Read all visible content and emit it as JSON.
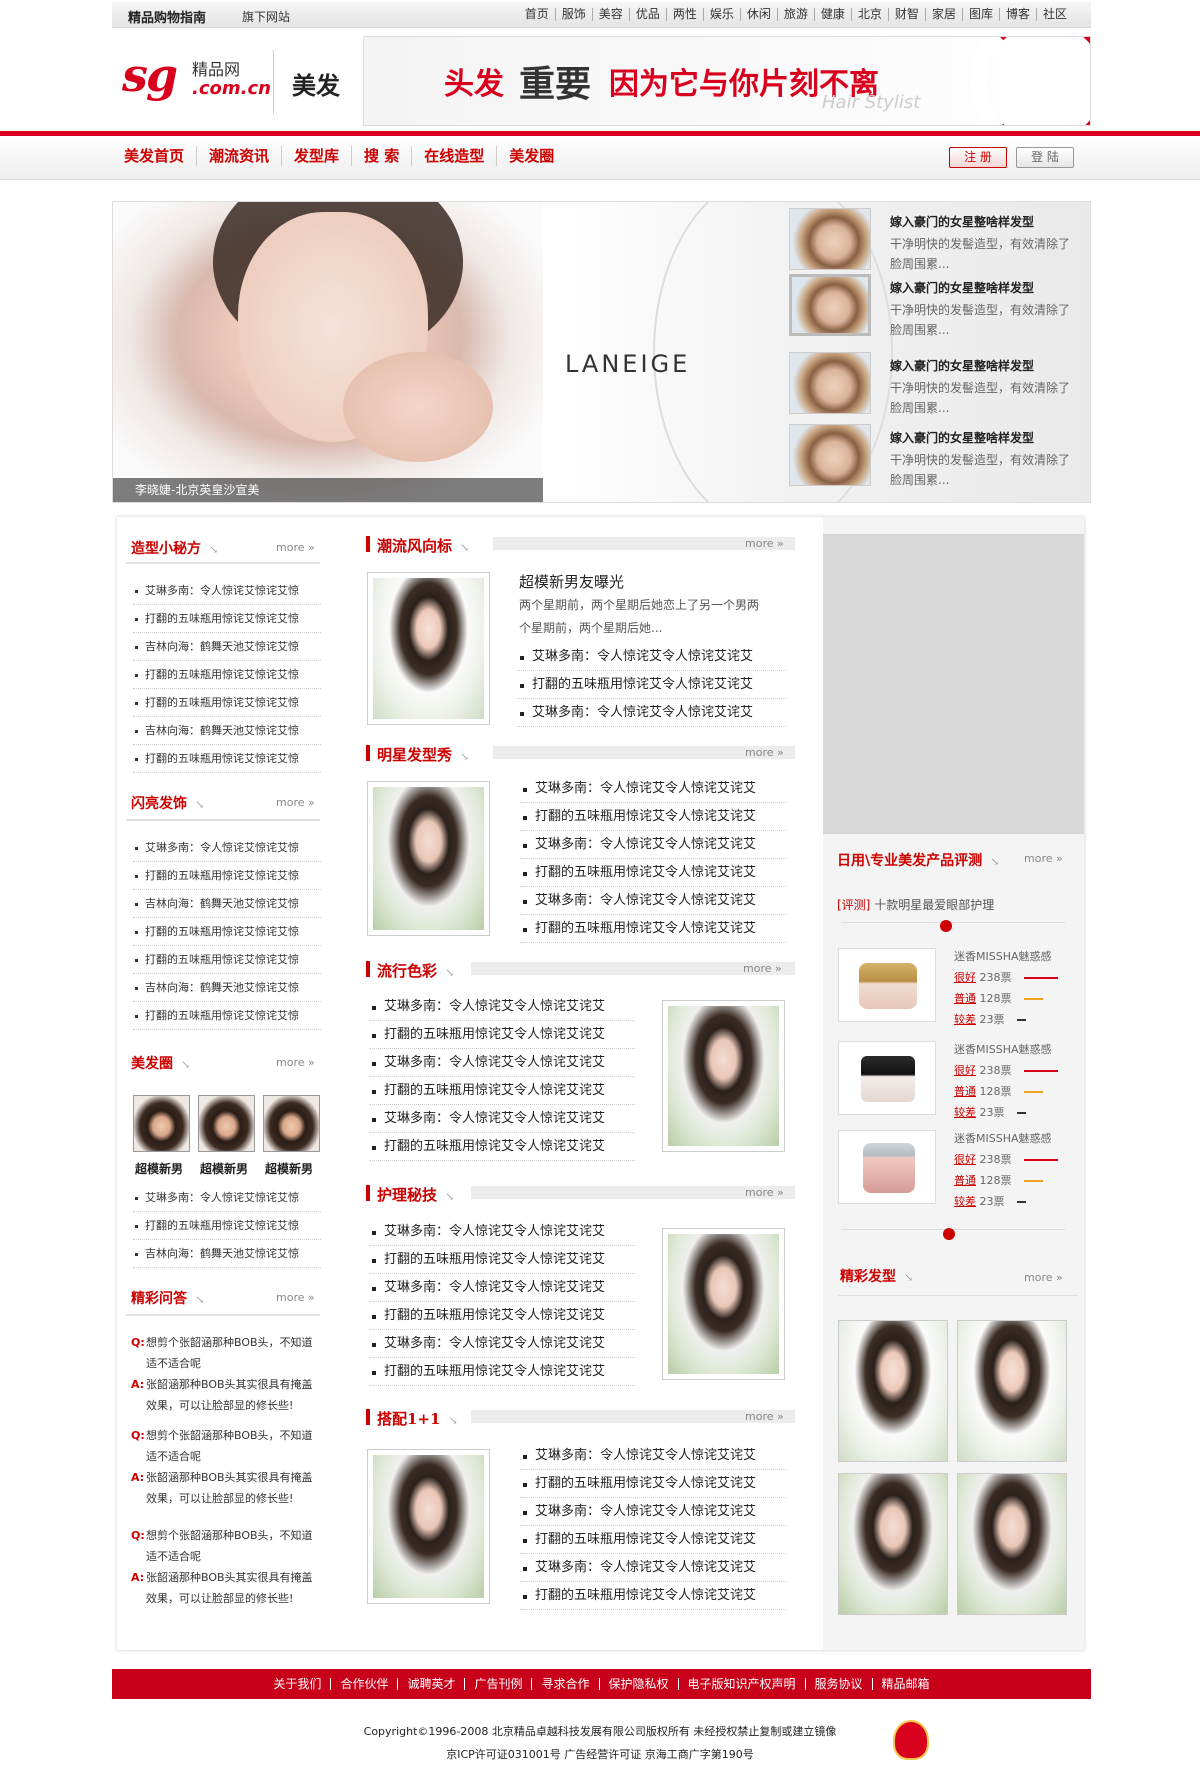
{
  "topbar": {
    "brand": "精品购物指南",
    "sub_site": "旗下网站",
    "links": [
      "首页",
      "服饰",
      "美容",
      "优品",
      "两性",
      "娱乐",
      "休闲",
      "旅游",
      "健康",
      "北京",
      "财智",
      "家居",
      "图库",
      "博客",
      "社区"
    ]
  },
  "header": {
    "logo_sg": "sg",
    "logo_jp": "精品网",
    "logo_com": ".com.cn",
    "section": "美发",
    "banner": {
      "t1": "头发",
      "t2": "重要",
      "t3": "因为它与你片刻不离",
      "t4": "Hair Stylist"
    }
  },
  "nav": {
    "items": [
      "美发首页",
      "潮流资讯",
      "发型库",
      "搜 索",
      "在线造型",
      "美发圈"
    ],
    "register": "注 册",
    "login": "登 陆"
  },
  "hero": {
    "brand_text": "LANEIGE",
    "caption": "李晓婕-北京英皇沙宣美",
    "items": [
      {
        "title": "嫁入豪门的女星整啥样发型",
        "desc": "干净明快的发髻造型，有效清除了脸周围累..."
      },
      {
        "title": "嫁入豪门的女星整啥样发型",
        "desc": "干净明快的发髻造型，有效清除了脸周围累..."
      },
      {
        "title": "嫁入豪门的女星整啥样发型",
        "desc": "干净明快的发髻造型，有效清除了脸周围累..."
      },
      {
        "title": "嫁入豪门的女星整啥样发型",
        "desc": "干净明快的发髻造型，有效清除了脸周围累..."
      }
    ]
  },
  "more": "more »",
  "left": {
    "sec1": {
      "title": "造型小秘方",
      "items": [
        "艾琳多南：令人惊诧艾惊诧艾惊",
        "打翻的五味瓶用惊诧艾惊诧艾惊",
        "吉林向海：鹤舞天池艾惊诧艾惊",
        "打翻的五味瓶用惊诧艾惊诧艾惊",
        "打翻的五味瓶用惊诧艾惊诧艾惊",
        "吉林向海：鹤舞天池艾惊诧艾惊",
        "打翻的五味瓶用惊诧艾惊诧艾惊"
      ]
    },
    "sec2": {
      "title": "闪亮发饰",
      "items": [
        "艾琳多南：令人惊诧艾惊诧艾惊",
        "打翻的五味瓶用惊诧艾惊诧艾惊",
        "吉林向海：鹤舞天池艾惊诧艾惊",
        "打翻的五味瓶用惊诧艾惊诧艾惊",
        "打翻的五味瓶用惊诧艾惊诧艾惊",
        "吉林向海：鹤舞天池艾惊诧艾惊",
        "打翻的五味瓶用惊诧艾惊诧艾惊"
      ]
    },
    "sec3": {
      "title": "美发圈",
      "photos": [
        "超模新男",
        "超模新男",
        "超模新男"
      ],
      "items": [
        "艾琳多南：令人惊诧艾惊诧艾惊",
        "打翻的五味瓶用惊诧艾惊诧艾惊",
        "吉林向海：鹤舞天池艾惊诧艾惊"
      ]
    },
    "sec4": {
      "title": "精彩问答",
      "qa": [
        {
          "q_label": "Q:",
          "q": "想剪个张韶涵那种BOB头，不知道适不适合呢",
          "a_label": "A:",
          "a": "张韶涵那种BOB头其实很具有掩盖效果，可以让脸部显的修长些!"
        },
        {
          "q_label": "Q:",
          "q": "想剪个张韶涵那种BOB头，不知道适不适合呢",
          "a_label": "A:",
          "a": "张韶涵那种BOB头其实很具有掩盖效果，可以让脸部显的修长些!"
        },
        {
          "q_label": "Q:",
          "q": "想剪个张韶涵那种BOB头，不知道适不适合呢",
          "a_label": "A:",
          "a": "张韶涵那种BOB头其实很具有掩盖效果，可以让脸部显的修长些!"
        }
      ]
    }
  },
  "center": {
    "trend": {
      "title": "潮流风向标",
      "headline": "超模新男友曝光",
      "summary": "两个星期前，两个星期后她恋上了另一个男两个星期前，两个星期后她...",
      "items": [
        "艾琳多南：令人惊诧艾令人惊诧艾诧艾",
        "打翻的五味瓶用惊诧艾令人惊诧艾诧艾",
        "艾琳多南：令人惊诧艾令人惊诧艾诧艾"
      ]
    },
    "star": {
      "title": "明星发型秀",
      "items": [
        "艾琳多南：令人惊诧艾令人惊诧艾诧艾",
        "打翻的五味瓶用惊诧艾令人惊诧艾诧艾",
        "艾琳多南：令人惊诧艾令人惊诧艾诧艾",
        "打翻的五味瓶用惊诧艾令人惊诧艾诧艾",
        "艾琳多南：令人惊诧艾令人惊诧艾诧艾",
        "打翻的五味瓶用惊诧艾令人惊诧艾诧艾"
      ]
    },
    "color": {
      "title": "流行色彩",
      "items": [
        "艾琳多南：令人惊诧艾令人惊诧艾诧艾",
        "打翻的五味瓶用惊诧艾令人惊诧艾诧艾",
        "艾琳多南：令人惊诧艾令人惊诧艾诧艾",
        "打翻的五味瓶用惊诧艾令人惊诧艾诧艾",
        "艾琳多南：令人惊诧艾令人惊诧艾诧艾",
        "打翻的五味瓶用惊诧艾令人惊诧艾诧艾"
      ]
    },
    "care": {
      "title": "护理秘技",
      "items": [
        "艾琳多南：令人惊诧艾令人惊诧艾诧艾",
        "打翻的五味瓶用惊诧艾令人惊诧艾诧艾",
        "艾琳多南：令人惊诧艾令人惊诧艾诧艾",
        "打翻的五味瓶用惊诧艾令人惊诧艾诧艾",
        "艾琳多南：令人惊诧艾令人惊诧艾诧艾",
        "打翻的五味瓶用惊诧艾令人惊诧艾诧艾"
      ]
    },
    "match": {
      "title": "搭配1+1",
      "items": [
        "艾琳多南：令人惊诧艾令人惊诧艾诧艾",
        "打翻的五味瓶用惊诧艾令人惊诧艾诧艾",
        "艾琳多南：令人惊诧艾令人惊诧艾诧艾",
        "打翻的五味瓶用惊诧艾令人惊诧艾诧艾",
        "艾琳多南：令人惊诧艾令人惊诧艾诧艾",
        "打翻的五味瓶用惊诧艾令人惊诧艾诧艾"
      ]
    }
  },
  "right": {
    "review": {
      "title": "日用\\专业美发产品评测",
      "tag": "[评测]",
      "headline": "十款明星最爱眼部护理",
      "products": [
        {
          "name": "迷香MISSHA魅惑感",
          "good": "很好",
          "good_votes": "238票",
          "ok": "普通",
          "ok_votes": "128票",
          "bad": "较差",
          "bad_votes": "23票"
        },
        {
          "name": "迷香MISSHA魅惑感",
          "good": "很好",
          "good_votes": "238票",
          "ok": "普通",
          "ok_votes": "128票",
          "bad": "较差",
          "bad_votes": "23票"
        },
        {
          "name": "迷香MISSHA魅惑感",
          "good": "很好",
          "good_votes": "238票",
          "ok": "普通",
          "ok_votes": "128票",
          "bad": "较差",
          "bad_votes": "23票"
        }
      ]
    },
    "gallery": {
      "title": "精彩发型"
    },
    "colors": {
      "good": "#d8001c",
      "ok": "#f0a020",
      "bad": "#333333"
    }
  },
  "footer": {
    "links": [
      "关于我们",
      "合作伙伴",
      "诚聘英才",
      "广告刊例",
      "寻求合作",
      "保护隐私权",
      "电子版知识产权声明",
      "服务协议",
      "精品邮箱"
    ],
    "copyright": "Copyright©1996-2008 北京精品卓越科技发展有限公司版权所有 未经授权禁止复制或建立镜像",
    "icp": "京ICP许可证031001号   广告经营许可证 京海工商广字第190号"
  }
}
